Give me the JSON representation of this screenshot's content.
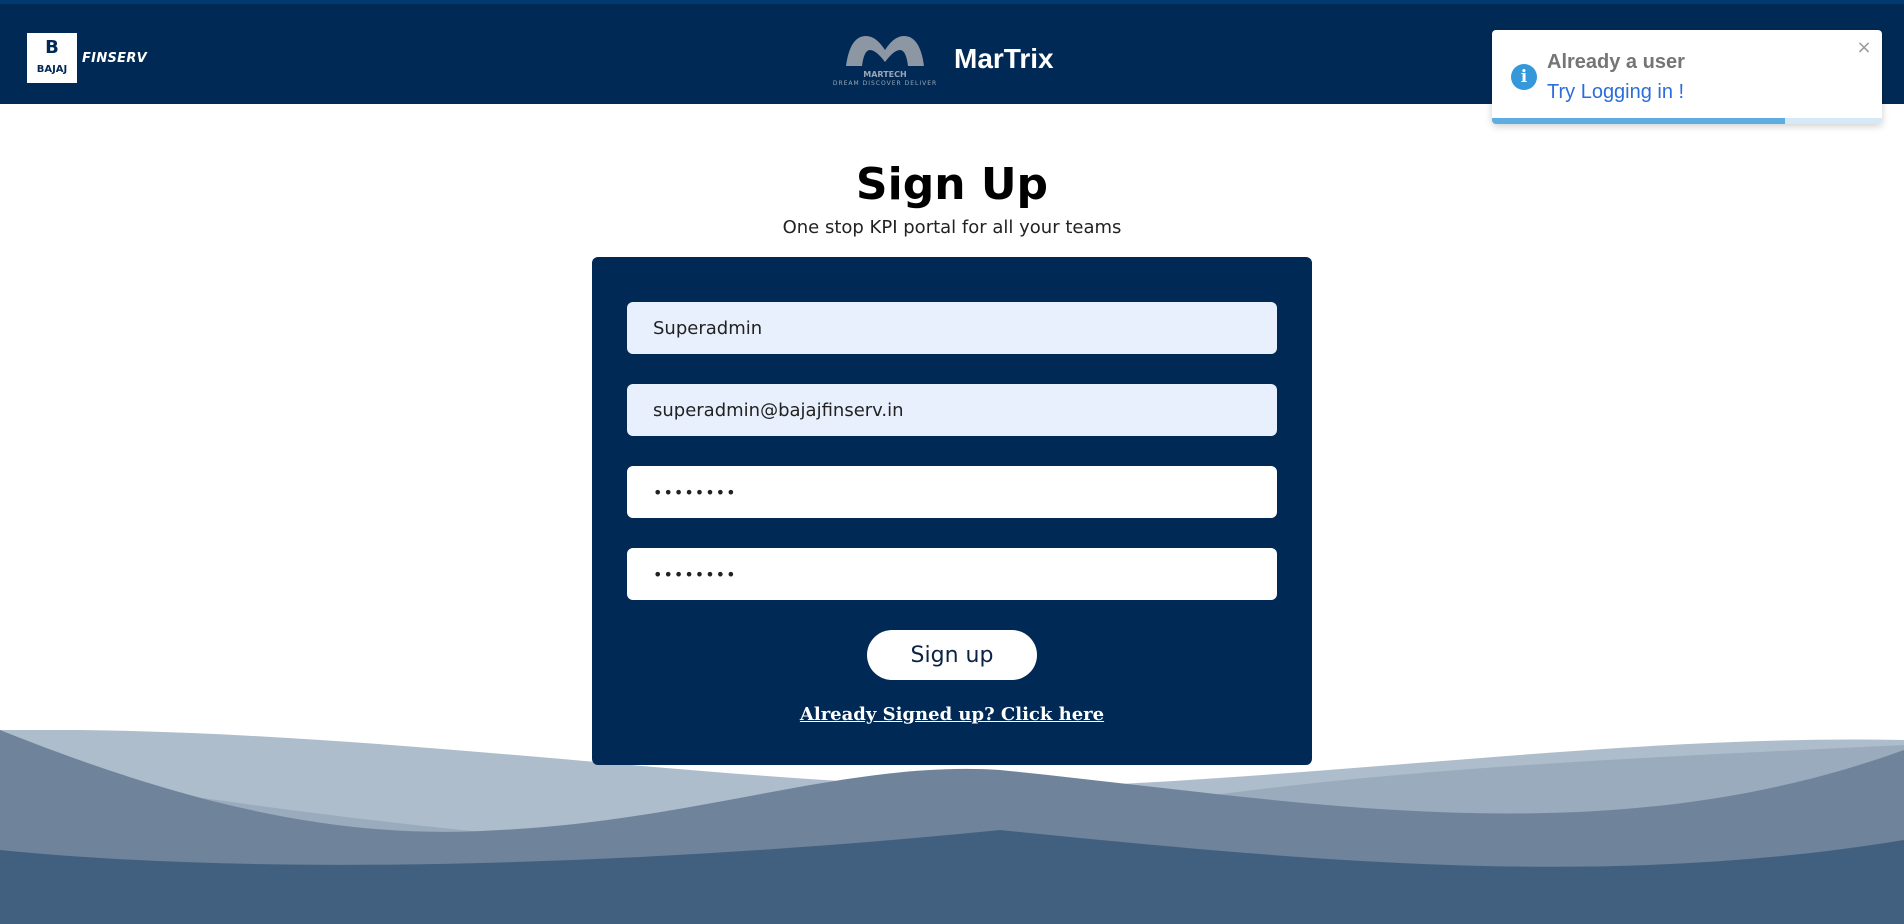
{
  "header": {
    "brand_mark": "B",
    "brand_sub": "BAJAJ",
    "brand_name": "FINSERV",
    "logo_text": "MARTECH",
    "logo_tagline": "DREAM DISCOVER DELIVER",
    "app_title": "MarTrix"
  },
  "toast": {
    "icon": "info-icon",
    "title": "Already a user",
    "message": "Try Logging in !",
    "close_label": "×",
    "progress": 0.75
  },
  "page": {
    "title": "Sign Up",
    "subtitle": "One stop KPI portal for all your teams"
  },
  "form": {
    "username_value": "Superadmin",
    "email_value": "superadmin@bajajfinserv.in",
    "password_value": "••••••••",
    "confirm_password_value": "••••••••",
    "submit_label": "Sign up",
    "login_link": "Already Signed up? Click here"
  },
  "colors": {
    "navy": "#002a55",
    "toast_accent": "#3498db",
    "link_blue": "#2a6edb"
  }
}
